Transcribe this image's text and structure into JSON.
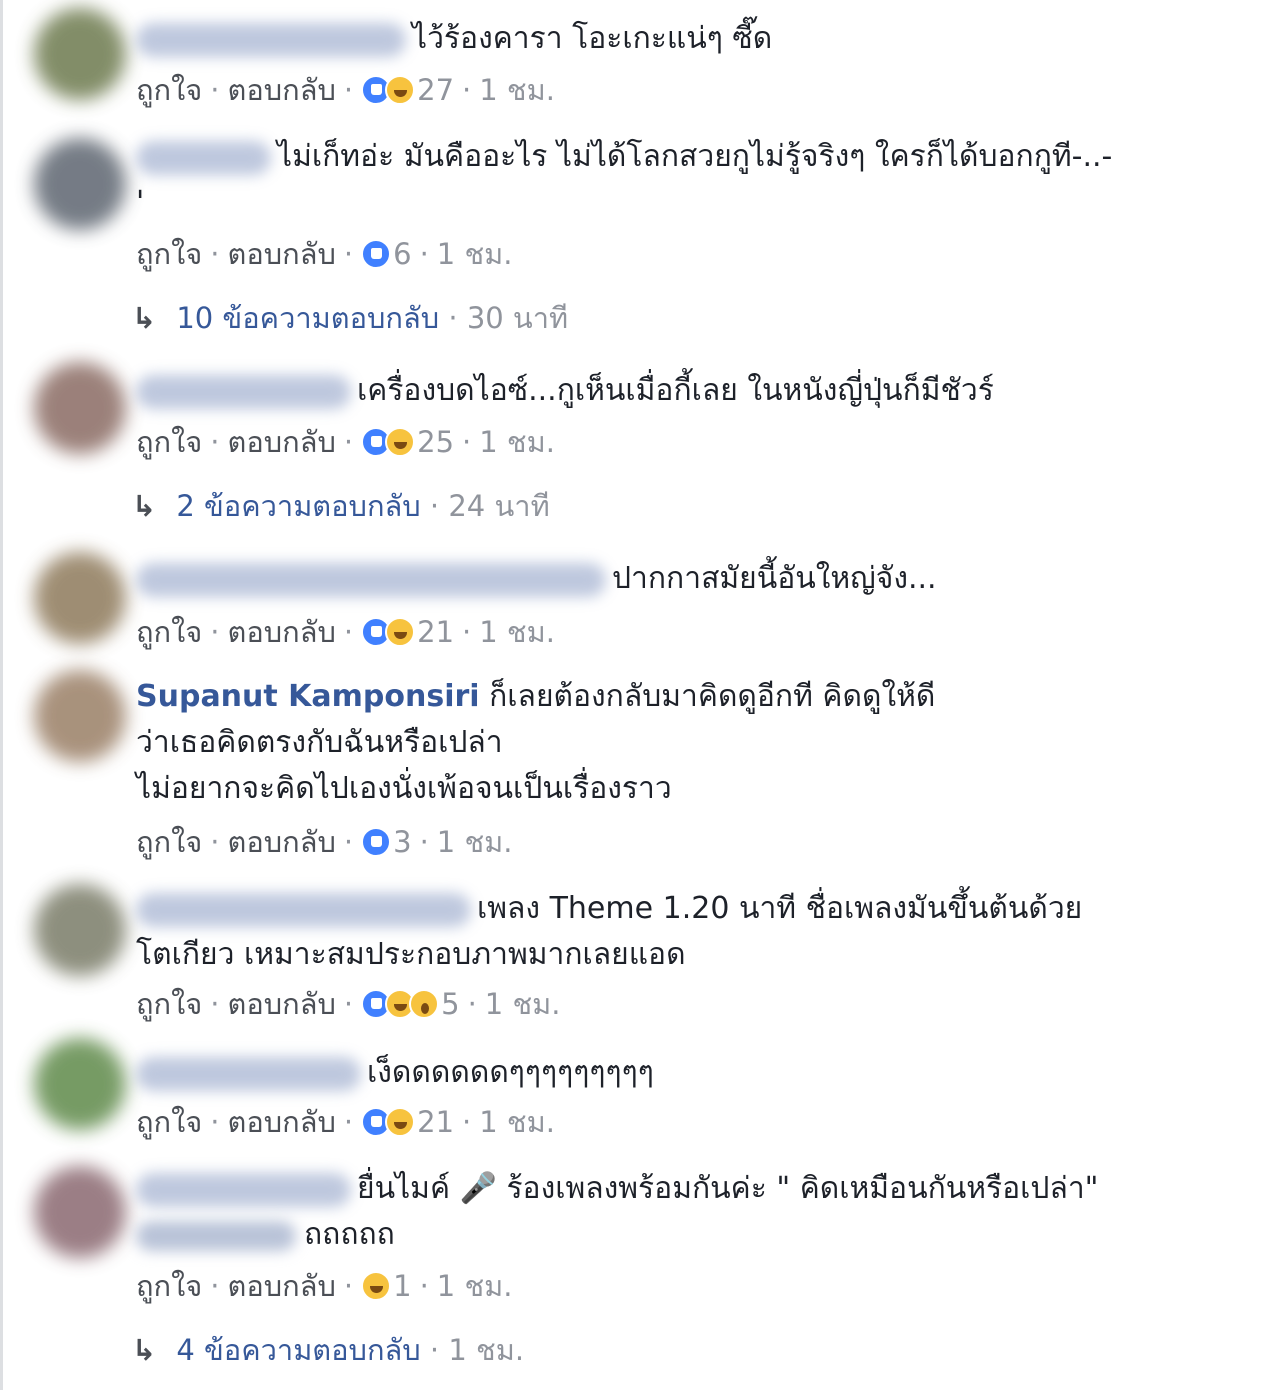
{
  "actions": {
    "like": "ถูกใจ",
    "reply": "ตอบกลับ",
    "separator": "·"
  },
  "comments": [
    {
      "text": "ไว้ร้องคารา โอะเกะแน่ๆ ซี๊ด",
      "count": "27",
      "time": "1 ชม."
    },
    {
      "text": "ไม่เก็ทอ่ะ มันคืออะไร ไม่ได้โลกสวยกูไม่รู้จริงๆ ใครก็ได้บอกกูที-..-",
      "text2": "'",
      "count": "6",
      "time": "1 ชม.",
      "replies": {
        "label": "10 ข้อความตอบกลับ",
        "time": "30 นาที"
      }
    },
    {
      "text": "เครื่องบดไอซ์...กูเห็นเมื่อกี้เลย ในหนังญี่ปุ่นก็มีชัวร์",
      "count": "25",
      "time": "1 ชม.",
      "replies": {
        "label": "2 ข้อความตอบกลับ",
        "time": "24 นาที"
      }
    },
    {
      "text": "ปากกาสมัยนี้อันใหญ่จัง...",
      "count": "21",
      "time": "1 ชม."
    },
    {
      "name": "Supanut Kamponsiri",
      "text": "ก็เลยต้องกลับมาคิดดูอีกที คิดดูให้ดี",
      "text2": "ว่าเธอคิดตรงกับฉันหรือเปล่า",
      "text3": "ไม่อยากจะคิดไปเองนั่งเพ้อจนเป็นเรื่องราว",
      "count": "3",
      "time": "1 ชม."
    },
    {
      "text": "เพลง Theme 1.20 นาที ชื่อเพลงมันขึ้นต้นด้วย",
      "text2": "โตเกียว เหมาะสมประกอบภาพมากเลยแอด",
      "count": "5",
      "time": "1 ชม."
    },
    {
      "text": "เง็ดดดดดดๆๆๆๆๆๆๆๆๆ",
      "count": "21",
      "time": "1 ชม."
    },
    {
      "text": "ยื่นไมค์ 🎤 ร้องเพลงพร้อมกันค่ะ \" คิดเหมือนกันหรือเปล่า\"",
      "text2": "ถถถถถ",
      "count": "1",
      "time": "1 ชม.",
      "replies": {
        "label": "4 ข้อความตอบกลับ",
        "time": "1 ชม."
      }
    }
  ],
  "colors": {
    "link": "#365899",
    "meta": "#90949c",
    "like": "#4080ff",
    "haha": "#f7c33e"
  }
}
